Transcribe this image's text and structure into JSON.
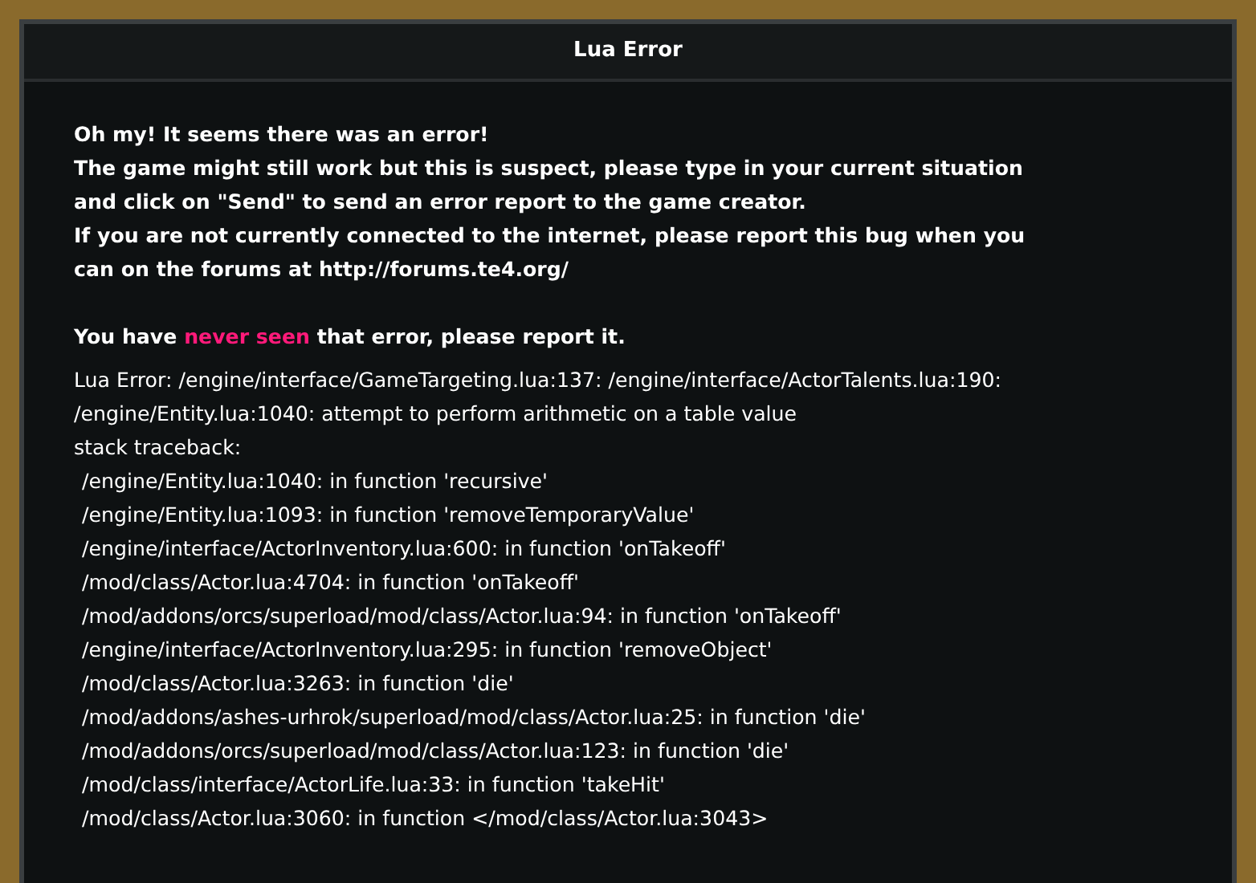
{
  "dialog": {
    "title": "Lua Error",
    "intro_lines": [
      "Oh my! It seems there was an error!",
      "The game might still work but this is suspect, please type in your current situation",
      "and click on \"Send\" to send an error report to the game creator.",
      "If you are not currently connected to the internet, please report this bug when you",
      "can on the forums at http://forums.te4.org/"
    ],
    "notice": {
      "before": "You have ",
      "highlight": "never seen",
      "after": " that error, please report it."
    },
    "log_lines": [
      "Lua Error: /engine/interface/GameTargeting.lua:137: /engine/interface/ActorTalents.lua:190:",
      "/engine/Entity.lua:1040: attempt to perform arithmetic on a table value",
      "stack traceback:"
    ],
    "traceback": [
      "/engine/Entity.lua:1040: in function 'recursive'",
      "/engine/Entity.lua:1093: in function 'removeTemporaryValue'",
      "/engine/interface/ActorInventory.lua:600: in function 'onTakeoff'",
      "/mod/class/Actor.lua:4704: in function 'onTakeoff'",
      "/mod/addons/orcs/superload/mod/class/Actor.lua:94: in function 'onTakeoff'",
      "/engine/interface/ActorInventory.lua:295: in function 'removeObject'",
      "/mod/class/Actor.lua:3263: in function 'die'",
      "/mod/addons/ashes-urhrok/superload/mod/class/Actor.lua:25: in function 'die'",
      "/mod/addons/orcs/superload/mod/class/Actor.lua:123: in function 'die'",
      "/mod/class/interface/ActorLife.lua:33: in function 'takeHit'",
      "/mod/class/Actor.lua:3060: in function </mod/class/Actor.lua:3043>"
    ]
  }
}
